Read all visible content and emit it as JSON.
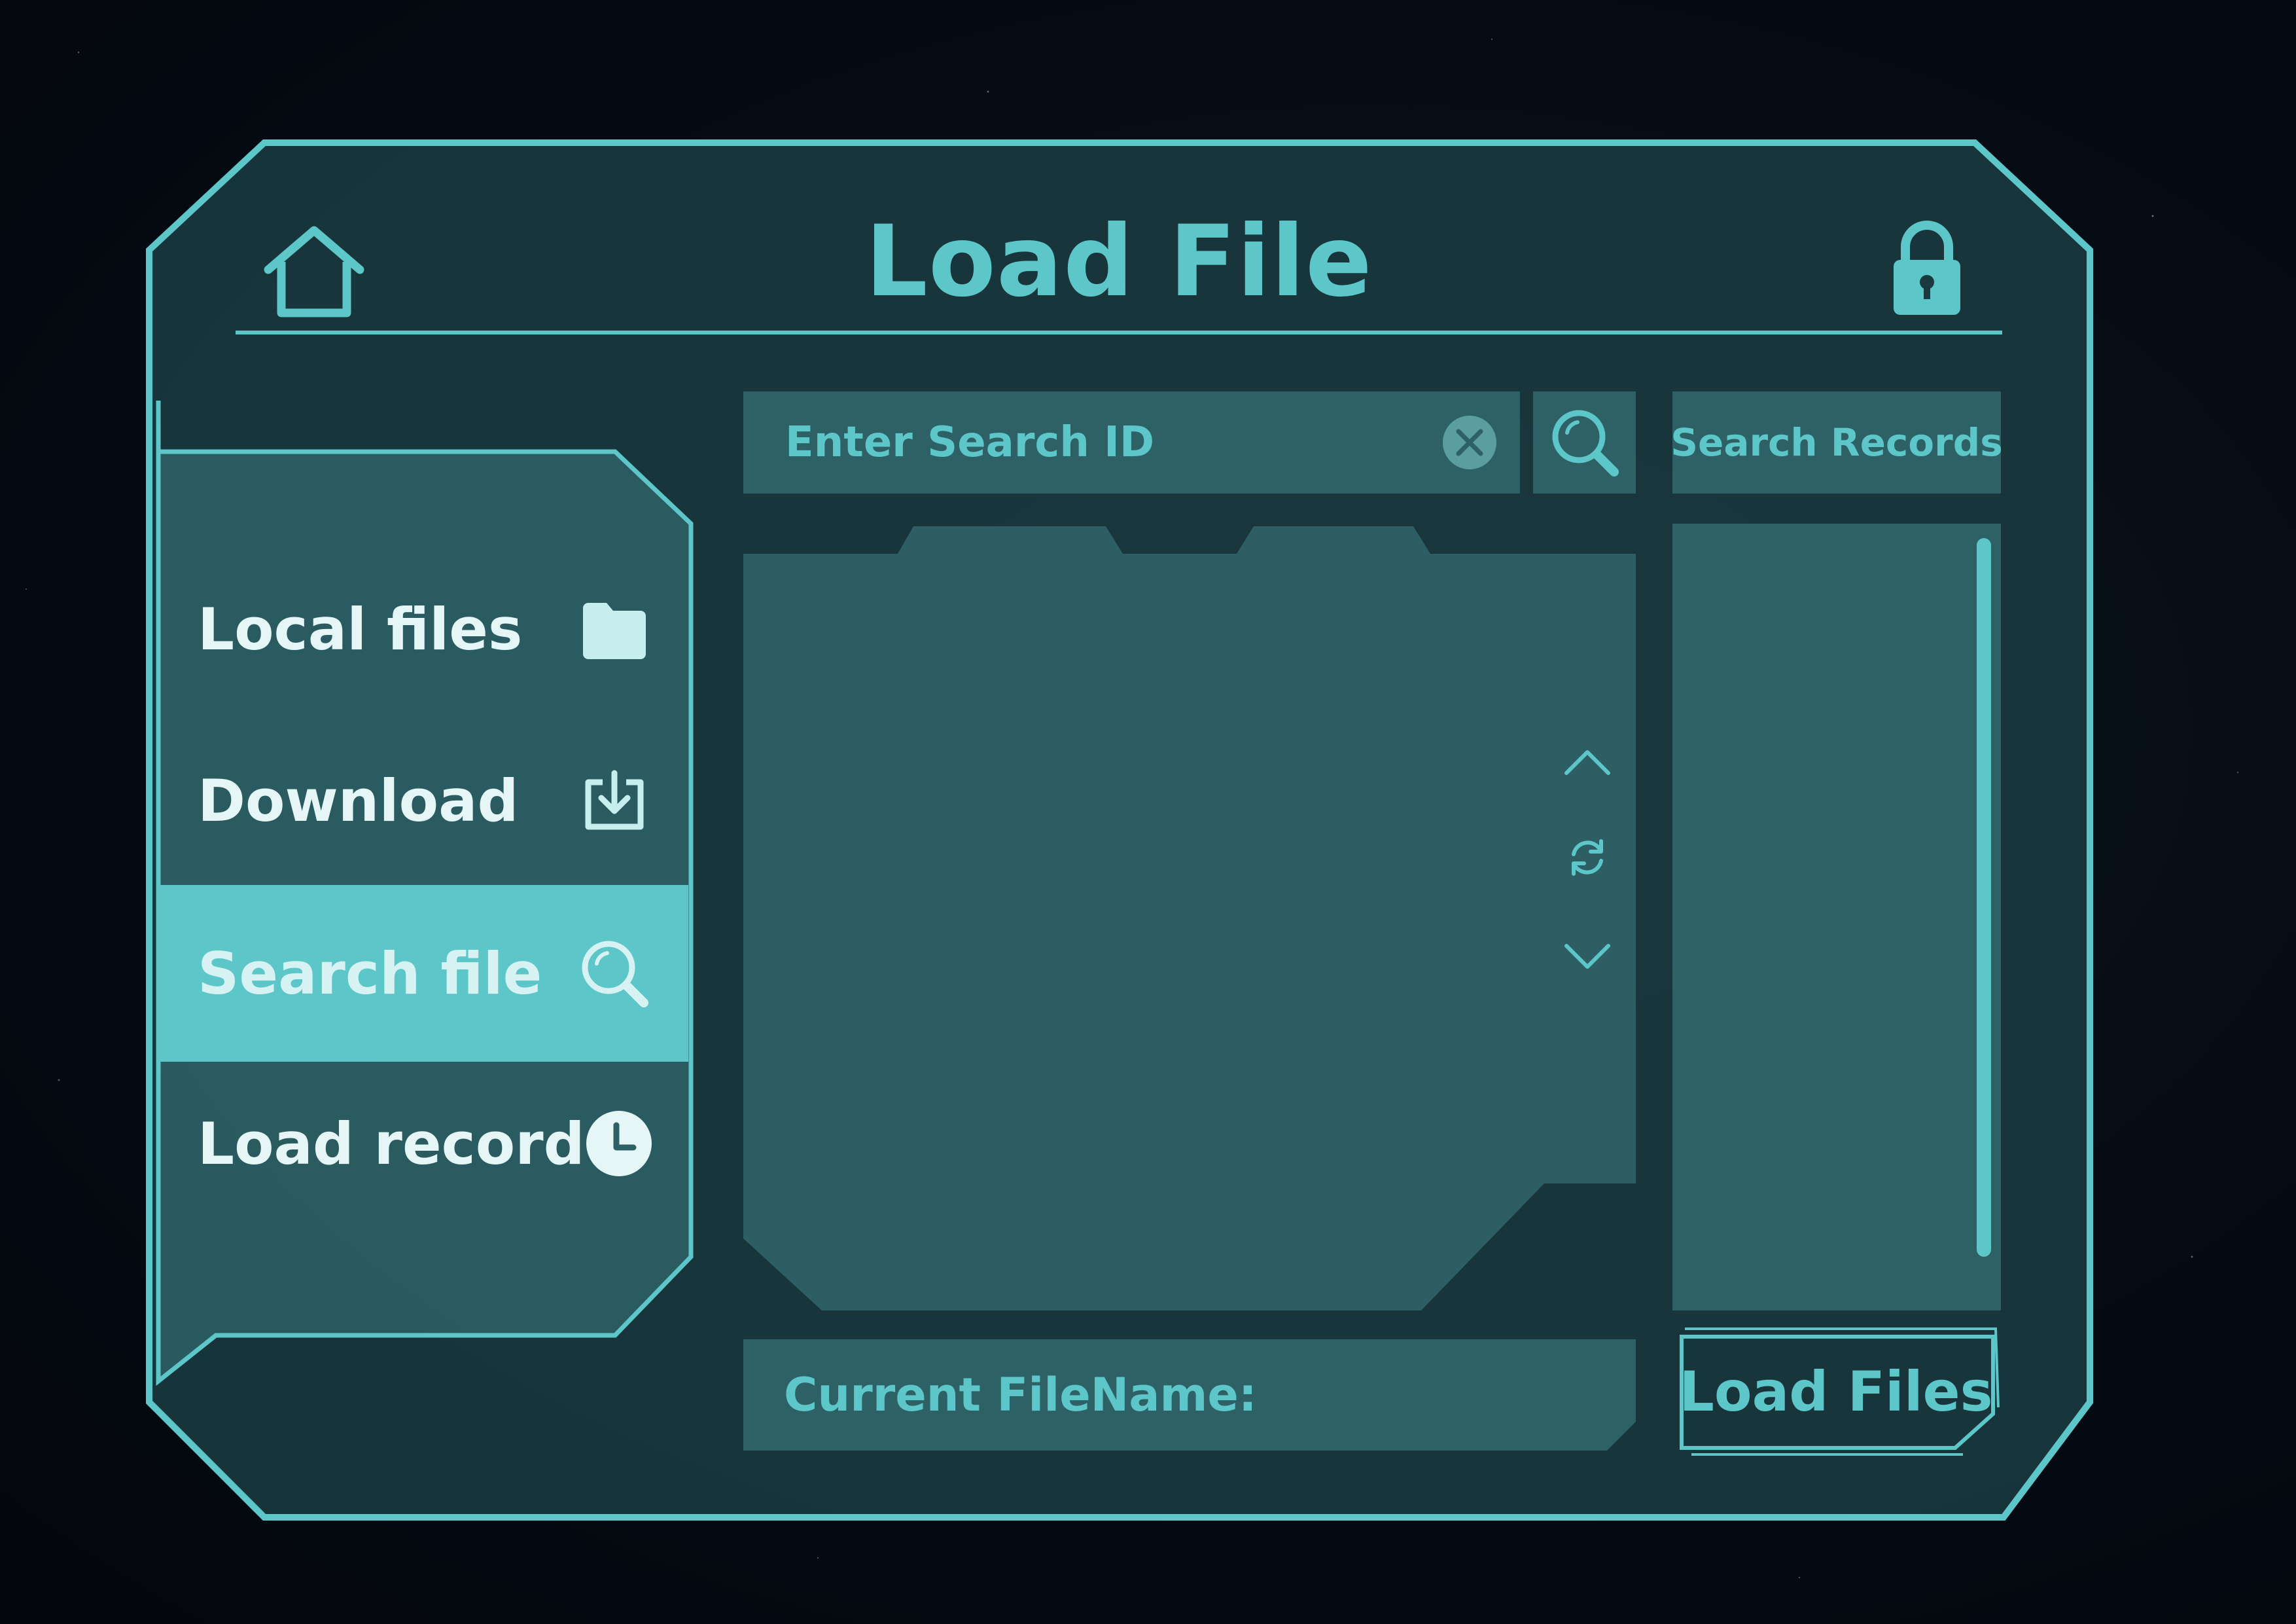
{
  "window": {
    "title": "Load File"
  },
  "header": {
    "home_icon": "home-icon",
    "lock_icon": "lock-icon"
  },
  "sidebar": {
    "items": [
      {
        "label": "Local files",
        "icon": "folder-icon",
        "active": false
      },
      {
        "label": "Download",
        "icon": "download-icon",
        "active": false
      },
      {
        "label": "Search file",
        "icon": "search-icon",
        "active": true
      },
      {
        "label": "Load record",
        "icon": "clock-icon",
        "active": false
      }
    ]
  },
  "search": {
    "placeholder": "Enter Search ID",
    "value": "",
    "clear_icon": "close-icon",
    "button_icon": "search-icon"
  },
  "records": {
    "button_label": "Search Records"
  },
  "viewer": {
    "controls": [
      "chevron-up-icon",
      "refresh-icon",
      "chevron-down-icon"
    ]
  },
  "footer": {
    "filename_label": "Current FileName:",
    "filename_value": "",
    "load_label": "Load Files"
  },
  "colors": {
    "accent": "#5cc6c9",
    "panel_bg": "#1b3a40",
    "field_bg": "#2d6166",
    "background": "#060b14"
  }
}
